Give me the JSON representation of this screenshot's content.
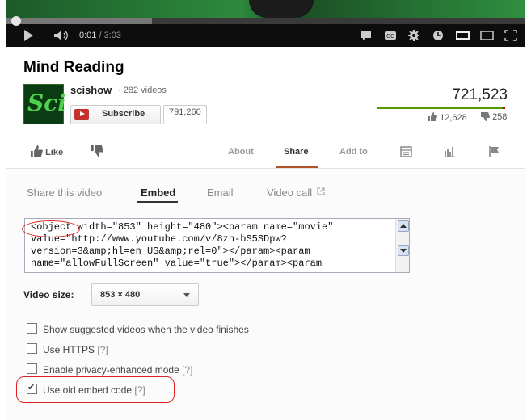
{
  "player": {
    "current_time": "0:01",
    "duration": "/ 3:03",
    "progress": 0.005
  },
  "video": {
    "title": "Mind Reading",
    "channel": "scishow",
    "video_count": "· 282 videos",
    "subscribe_label": "Subscribe",
    "subscriber_count": "791,260",
    "views": "721,523",
    "likes": "12,628",
    "dislikes": "258",
    "like_ratio": 0.98,
    "avatar_text": "Sci"
  },
  "actions": {
    "like_label": "Like",
    "tabs": [
      "About",
      "Share",
      "Add to"
    ]
  },
  "share": {
    "tabs": [
      "Share this video",
      "Embed",
      "Email",
      "Video call"
    ],
    "embed_code": "<object width=\"853\" height=\"480\"><param name=\"movie\"\nvalue=\"http://www.youtube.com/v/8zh-bS5SDpw?\nversion=3&amp;hl=en_US&amp;rel=0\"></param><param\nname=\"allowFullScreen\" value=\"true\"></param><param",
    "video_size_label": "Video size:",
    "video_size_value": "853 × 480",
    "options": [
      {
        "label": "Show suggested videos when the video finishes",
        "help": "",
        "checked": false
      },
      {
        "label": "Use HTTPS",
        "help": "[?]",
        "checked": false
      },
      {
        "label": "Enable privacy-enhanced mode",
        "help": "[?]",
        "checked": false
      },
      {
        "label": "Use old embed code",
        "help": "[?]",
        "checked": true
      }
    ]
  },
  "colors": {
    "accent": "#b1502a",
    "like_bar": "#559900",
    "annotation": "#dd2222"
  }
}
